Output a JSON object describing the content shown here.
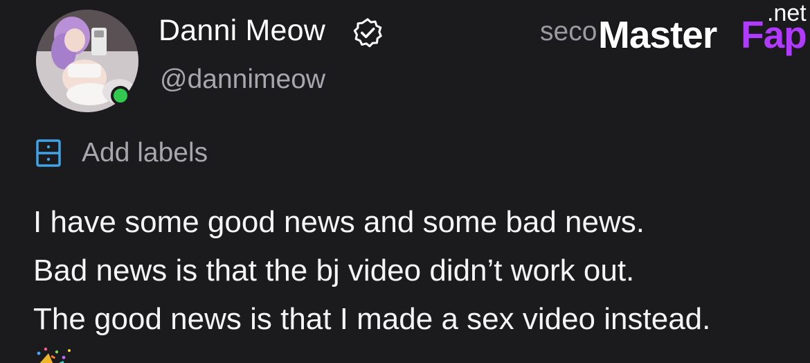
{
  "profile": {
    "display_name": "Danni Meow",
    "handle": "@dannimeow",
    "timestamp": "seco",
    "verified_icon": "verified-badge-icon",
    "online": true,
    "online_color": "#33c84f"
  },
  "watermark": {
    "master": "Master",
    "fap": "Fap",
    "net": ".net",
    "accent": "#b13aff"
  },
  "labels": {
    "icon": "label-drawer-icon",
    "text": "Add labels",
    "icon_color": "#3fa4e8"
  },
  "post": {
    "lines": [
      "I have some good news and some bad news.",
      "Bad news is that the bj video didn’t work out.",
      "The good news is that I made a sex video instead."
    ],
    "emoji": "party-popper-icon"
  }
}
